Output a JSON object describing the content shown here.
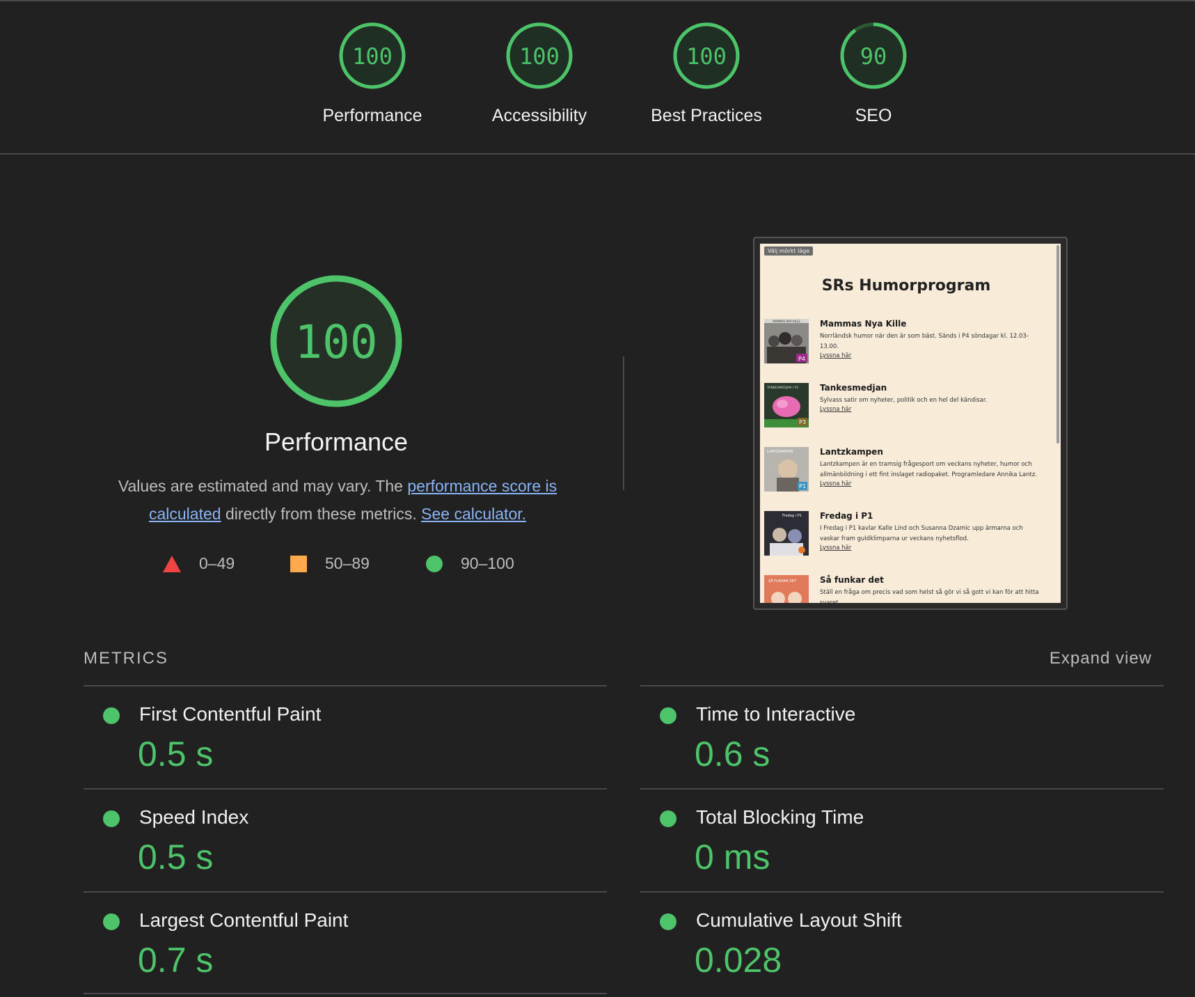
{
  "gauges": [
    {
      "score": "100",
      "label": "Performance",
      "fraction": 1.0
    },
    {
      "score": "100",
      "label": "Accessibility",
      "fraction": 1.0
    },
    {
      "score": "100",
      "label": "Best Practices",
      "fraction": 1.0
    },
    {
      "score": "90",
      "label": "SEO",
      "fraction": 0.9
    }
  ],
  "main": {
    "score": "100",
    "title": "Performance",
    "desc_prefix": "Values are estimated and may vary. The ",
    "link_score": "performance score is calculated",
    "desc_middle": " directly from these metrics. ",
    "link_calc": "See calculator."
  },
  "legend": {
    "fail": "0–49",
    "average": "50–89",
    "pass": "90–100"
  },
  "preview": {
    "mode_button": "Välj mörkt läge",
    "title": "SRs Humorprogram",
    "items": [
      {
        "name": "Mammas Nya Kille",
        "desc": "Norrländsk humor när den är som bäst. Sänds i P4 söndagar kl. 12.03-13.00.",
        "link": "Lyssna här",
        "thumb_label": "MAMMAS NYA KILLE",
        "badge": "P4"
      },
      {
        "name": "Tankesmedjan",
        "desc": "Sylvass satir om nyheter, politik och en hel del kändisar.",
        "link": "Lyssna här",
        "thumb_label": "TANKESMEDJAN I P3",
        "badge": "P3"
      },
      {
        "name": "Lantzkampen",
        "desc": "Lantzkampen är en tramsig frågesport om veckans nyheter, humor och allmänbildning i ett fint inslaget radiopaket. Programledare Annika Lantz.",
        "link": "Lyssna här",
        "thumb_label": "LANTZKAMPEN",
        "badge": "P1"
      },
      {
        "name": "Fredag i P1",
        "desc": "I Fredag i P1 kavlar Kalle Lind och Susanna Dzamic upp ärmarna och vaskar fram guldklimparna ur veckans nyhetsflod.",
        "link": "Lyssna här",
        "thumb_label": "Fredag i P1",
        "badge": ""
      },
      {
        "name": "Så funkar det",
        "desc": "Ställ en fråga om precis vad som helst så gör vi så gott vi kan för att hitta svaret.",
        "link": "",
        "thumb_label": "SÅ FUNKAR DET",
        "badge": ""
      }
    ]
  },
  "metrics": {
    "heading": "METRICS",
    "expand": "Expand view",
    "items": [
      {
        "label": "First Contentful Paint",
        "value": "0.5 s"
      },
      {
        "label": "Time to Interactive",
        "value": "0.6 s"
      },
      {
        "label": "Speed Index",
        "value": "0.5 s"
      },
      {
        "label": "Total Blocking Time",
        "value": "0 ms"
      },
      {
        "label": "Largest Contentful Paint",
        "value": "0.7 s"
      },
      {
        "label": "Cumulative Layout Shift",
        "value": "0.028"
      }
    ]
  },
  "colors": {
    "pass": "#4ec46a",
    "average": "#ffa94d",
    "fail": "#ef4444",
    "background": "#212121"
  }
}
